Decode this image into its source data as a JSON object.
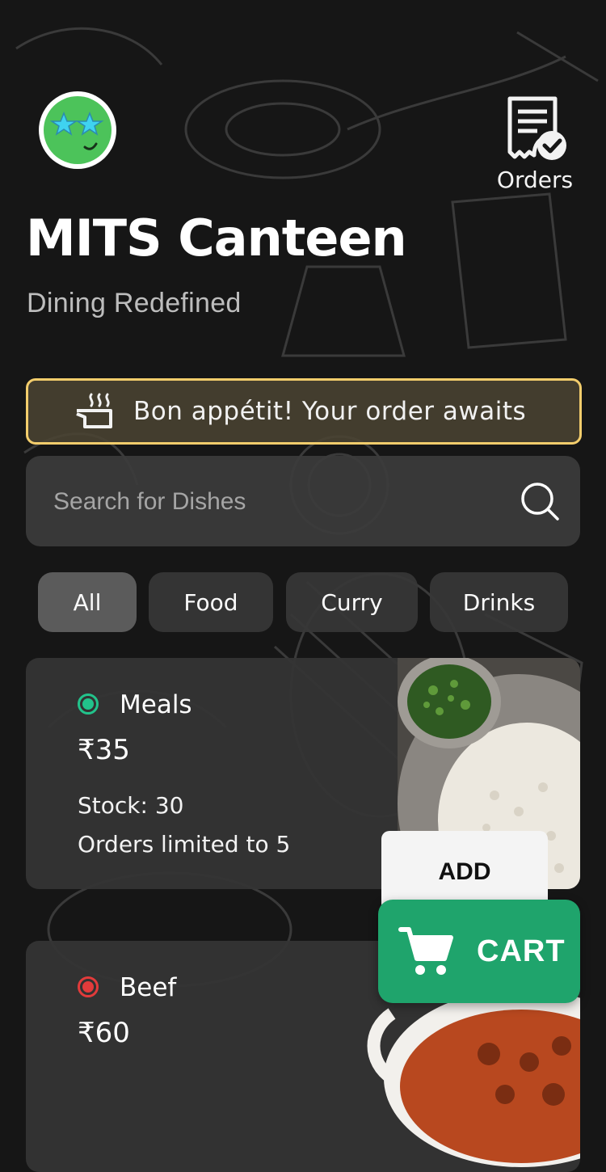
{
  "header": {
    "title": "MITS Canteen",
    "subtitle": "Dining Redefined",
    "orders_label": "Orders"
  },
  "banner": {
    "text": "Bon appétit! Your order awaits"
  },
  "search": {
    "placeholder": "Search for Dishes"
  },
  "filters": [
    {
      "label": "All",
      "active": true
    },
    {
      "label": "Food",
      "active": false
    },
    {
      "label": "Curry",
      "active": false
    },
    {
      "label": "Drinks",
      "active": false
    }
  ],
  "menu": [
    {
      "name": "Meals",
      "price": "₹35",
      "stock": "Stock: 30",
      "limit": "Orders limited to 5",
      "type": "veg",
      "add_label": "ADD"
    },
    {
      "name": "Beef",
      "price": "₹60",
      "type": "non-veg"
    }
  ],
  "cart": {
    "label": "CART"
  },
  "colors": {
    "accent": "#1fa46c",
    "banner_border": "#f3cd6c",
    "veg": "#22c38b",
    "non_veg": "#e23b3b"
  }
}
